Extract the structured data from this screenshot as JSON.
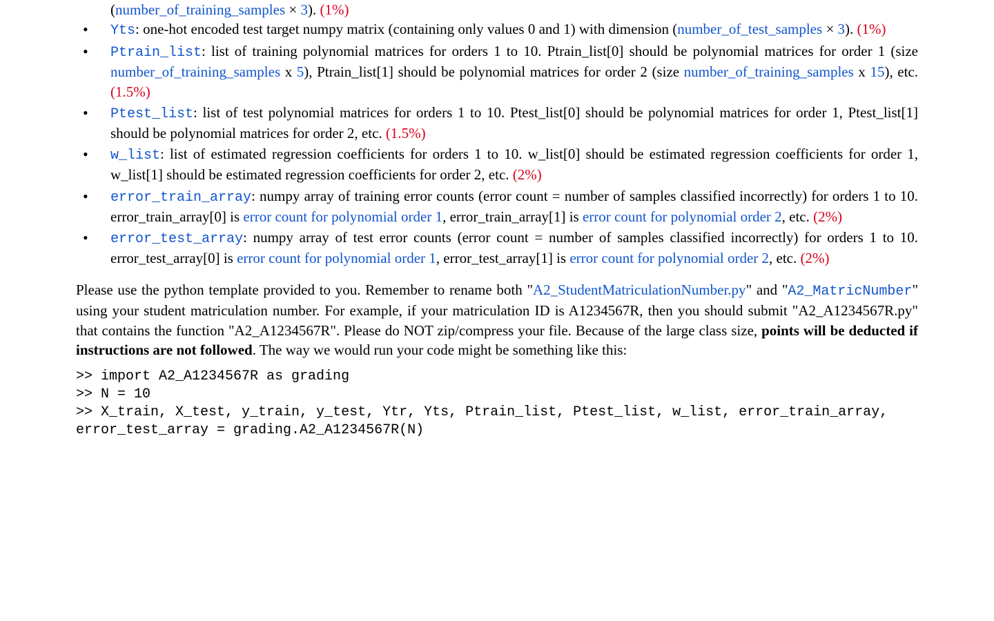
{
  "top": {
    "cont_pre": "(",
    "cont_var": "number_of_training_samples",
    "cont_times": " × ",
    "cont_three": "3",
    "cont_close": "). ",
    "cont_pct": "(1%)"
  },
  "items": [
    {
      "var": "Yts",
      "text1": ":   one-hot encoded test target numpy matrix (containing only values 0 and 1) with dimension (",
      "blue1": "number_of_test_samples",
      "times": " × ",
      "three": "3",
      "text2": "). ",
      "pct": "(1%)"
    },
    {
      "var": "Ptrain_list",
      "text1": ":  list of training polynomial matrices for orders 1 to 10. Ptrain_list[0] should be polynomial matrices for order 1 (size ",
      "blue1": "number_of_training_samples",
      "text2": " x ",
      "blue2": "5",
      "text3": "), Ptrain_list[1] should be polynomial matrices for order 2 (size ",
      "blue3": "number_of_training_samples",
      "text4": " x ",
      "blue4": "15",
      "text5": "), etc.  ",
      "pct": "(1.5%)"
    },
    {
      "var": "Ptest_list",
      "text1": ":  list of test polynomial matrices for orders 1 to 10. Ptest_list[0] should be polynomial matrices for order 1, Ptest_list[1] should be polynomial matrices for order 2, etc. ",
      "pct": "(1.5%)"
    },
    {
      "var": "w_list",
      "text1": ": list of estimated regression coefficients for orders 1 to 10. w_list[0] should be estimated regression coefficients for order 1, w_list[1] should be estimated regression coefficients for order 2, etc. ",
      "pct": "(2%)"
    },
    {
      "var": "error_train_array",
      "text1": ":  numpy array of training error counts (error count = number of samples classified incorrectly) for orders 1 to 10.  error_train_array[0] is ",
      "blue1": "error count for polynomial order 1",
      "text2": ", error_train_array[1] is ",
      "blue2": "error count for polynomial order 2",
      "text3": ", etc. ",
      "pct": "(2%)"
    },
    {
      "var": "error_test_array",
      "text1": ": numpy array of test error counts (error count = number of samples classified incorrectly) for orders 1 to 10. error_test_array[0] is ",
      "blue1": "error count for polynomial order 1",
      "text2": ", error_test_array[1] is ",
      "blue2": "error count for polynomial order 2",
      "text3": ", etc. ",
      "pct": "(2%)"
    }
  ],
  "para": {
    "t1": "Please use the python template provided to you. Remember to rename both \"",
    "py": "A2_StudentMatriculationNumber.py",
    "t2": "\" and \"",
    "fn": "A2_MatricNumber",
    "t3": "\" using your student matriculation number. For example, if your matriculation ID is A1234567R, then you should submit \"A2_A1234567R.py\" that contains the function \"A2_A1234567R\". Please do NOT zip/compress your file. Because of the large class size, ",
    "bold": "points will be deducted if instructions are not followed",
    "t4": ". The way we would run your code might be something like this:"
  },
  "code": ">> import A2_A1234567R as grading\n>> N = 10\n>> X_train, X_test, y_train, y_test, Ytr, Yts, Ptrain_list, Ptest_list, w_list, error_train_array, error_test_array = grading.A2_A1234567R(N)"
}
